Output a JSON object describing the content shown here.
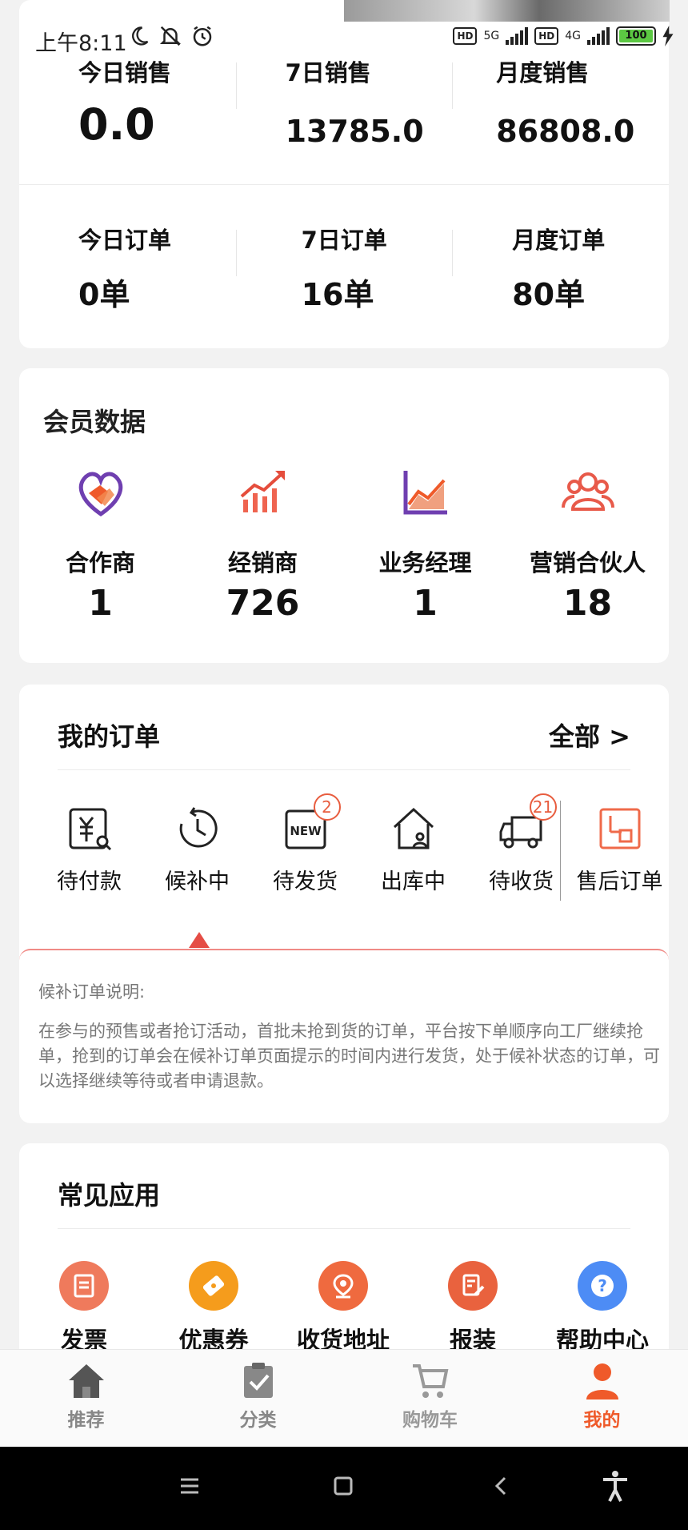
{
  "status_bar": {
    "time": "上午8:11",
    "net1": "5G",
    "net2": "4G",
    "hd": "HD",
    "battery": "100"
  },
  "sales": {
    "today_label": "今日销售",
    "today_value": "0.0",
    "week_label": "7日销售",
    "week_value": "13785.0",
    "month_label": "月度销售",
    "month_value": "86808.0",
    "today_orders_label": "今日订单",
    "today_orders_value": "0单",
    "week_orders_label": "7日订单",
    "week_orders_value": "16单",
    "month_orders_label": "月度订单",
    "month_orders_value": "80单"
  },
  "member": {
    "title": "会员数据",
    "items": [
      {
        "label": "合作商",
        "value": "1",
        "icon": "handshake-heart-icon"
      },
      {
        "label": "经销商",
        "value": "726",
        "icon": "growth-chart-icon"
      },
      {
        "label": "业务经理",
        "value": "1",
        "icon": "line-chart-icon"
      },
      {
        "label": "营销合伙人",
        "value": "18",
        "icon": "group-users-icon"
      }
    ]
  },
  "orders": {
    "title": "我的订单",
    "all_link": "全部 >",
    "items": [
      {
        "label": "待付款",
        "icon": "yuan-search-icon"
      },
      {
        "label": "候补中",
        "icon": "clock-icon"
      },
      {
        "label": "待发货",
        "icon": "new-box-icon",
        "badge": "2"
      },
      {
        "label": "出库中",
        "icon": "house-person-icon"
      },
      {
        "label": "待收货",
        "icon": "truck-icon",
        "badge": "21"
      },
      {
        "label": "售后订单",
        "icon": "after-sale-icon"
      }
    ],
    "tip_title": "候补订单说明:",
    "tip_text": "在参与的预售或者抢订活动，首批未抢到货的订单，平台按下单顺序向工厂继续抢单，抢到的订单会在候补订单页面提示的时间内进行发货，处于候补状态的订单，可以选择继续等待或者申请退款。"
  },
  "apps": {
    "title": "常见应用",
    "items": [
      {
        "label": "发票",
        "icon": "invoice-icon",
        "color": "#ef7a5c"
      },
      {
        "label": "优惠券",
        "icon": "coupon-icon",
        "color": "#f59c1c"
      },
      {
        "label": "收货地址",
        "icon": "location-icon",
        "color": "#ef6a3f"
      },
      {
        "label": "报装",
        "icon": "report-install-icon",
        "color": "#e9623e"
      },
      {
        "label": "帮助中心",
        "icon": "help-icon",
        "color": "#4d8cf5"
      }
    ]
  },
  "tabs": [
    {
      "label": "推荐",
      "icon": "home-icon"
    },
    {
      "label": "分类",
      "icon": "clipboard-icon"
    },
    {
      "label": "购物车",
      "icon": "cart-icon"
    },
    {
      "label": "我的",
      "icon": "profile-icon",
      "active": true
    }
  ],
  "colors": {
    "accent": "#ef5a2a",
    "tab_inactive": "#888888"
  }
}
